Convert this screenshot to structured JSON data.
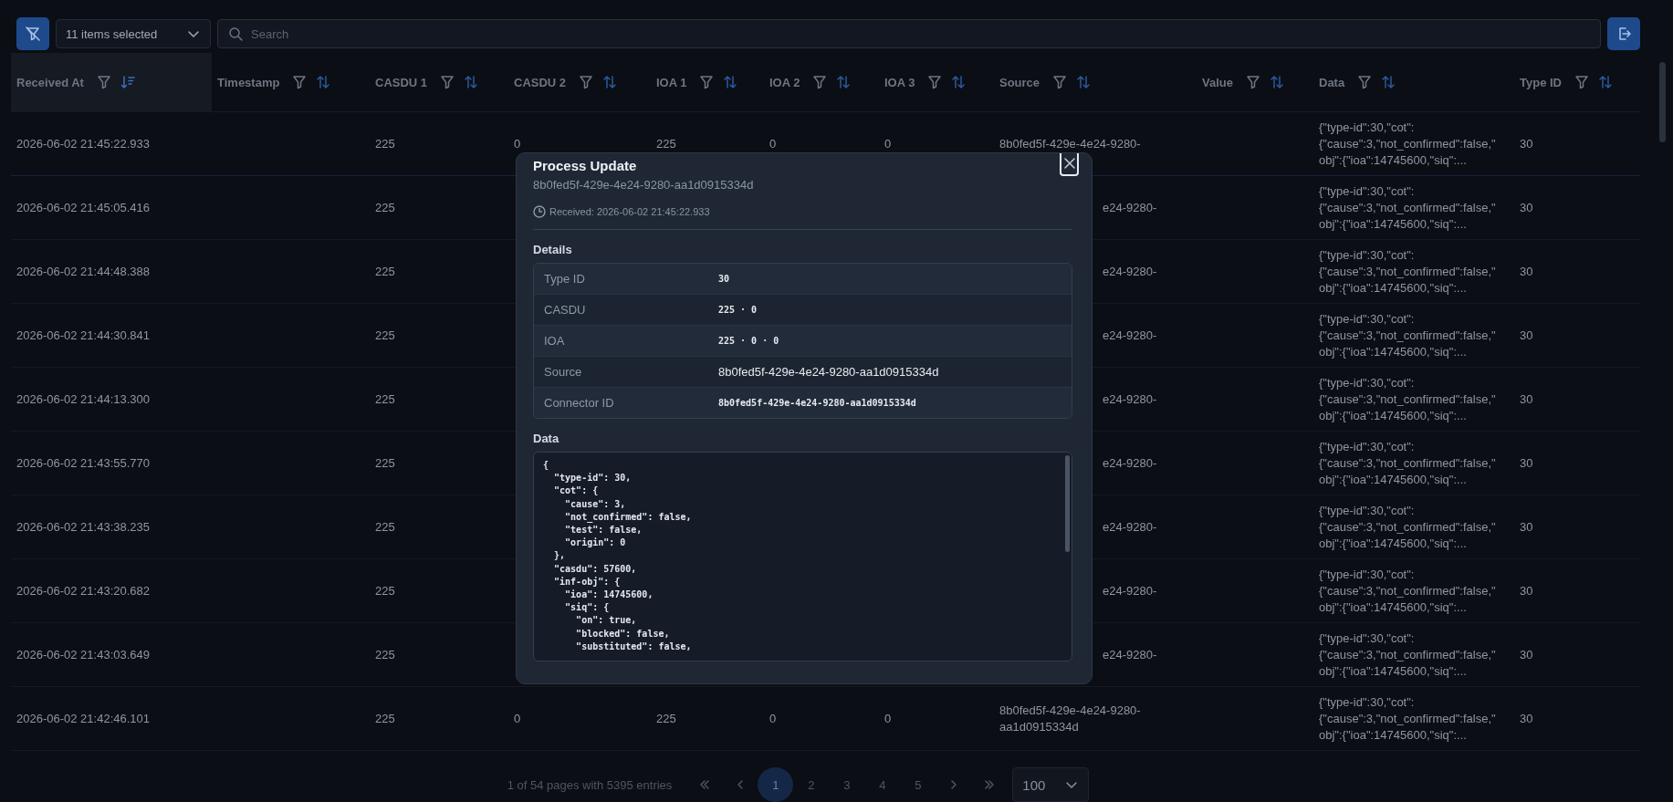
{
  "toolbar": {
    "column_select": "11 items selected",
    "search": {
      "placeholder": "Search"
    }
  },
  "table": {
    "columns": [
      {
        "label": "Received At",
        "sorted": true
      },
      {
        "label": "Timestamp",
        "sorted": false
      },
      {
        "label": "CASDU 1",
        "sorted": false
      },
      {
        "label": "CASDU 2",
        "sorted": false
      },
      {
        "label": "IOA 1",
        "sorted": false
      },
      {
        "label": "IOA 2",
        "sorted": false
      },
      {
        "label": "IOA 3",
        "sorted": false
      },
      {
        "label": "Source",
        "sorted": false
      },
      {
        "label": "Value",
        "sorted": false
      },
      {
        "label": "Data",
        "sorted": false
      },
      {
        "label": "Type ID",
        "sorted": false
      }
    ],
    "rows": [
      {
        "kind": "full",
        "received_at": "2026-06-02 21:45:22.933",
        "casdu_1": "225",
        "casdu_2": "0",
        "ioa_1": "225",
        "ioa_2": "0",
        "ioa_3": "0",
        "source": "8b0fed5f-429e-4e24-9280-",
        "data": [
          "{\"type-id\":30,\"cot\":",
          "{\"cause\":3,\"not_confirmed\":false,\"",
          "obj\":{\"ioa\":14745600,\"siq\":..."
        ],
        "type_id": "30"
      },
      {
        "kind": "partial",
        "received_at": "2026-06-02 21:45:05.416",
        "casdu_1": "225",
        "source": "e24-9280-",
        "data": [
          "{\"type-id\":30,\"cot\":",
          "{\"cause\":3,\"not_confirmed\":false,\"",
          "obj\":{\"ioa\":14745600,\"siq\":..."
        ],
        "type_id": "30"
      },
      {
        "kind": "partial",
        "received_at": "2026-06-02 21:44:48.388",
        "casdu_1": "225",
        "source": "e24-9280-",
        "data": [
          "{\"type-id\":30,\"cot\":",
          "{\"cause\":3,\"not_confirmed\":false,\"",
          "obj\":{\"ioa\":14745600,\"siq\":..."
        ],
        "type_id": "30"
      },
      {
        "kind": "partial",
        "received_at": "2026-06-02 21:44:30.841",
        "casdu_1": "225",
        "source": "e24-9280-",
        "data": [
          "{\"type-id\":30,\"cot\":",
          "{\"cause\":3,\"not_confirmed\":false,\"",
          "obj\":{\"ioa\":14745600,\"siq\":..."
        ],
        "type_id": "30"
      },
      {
        "kind": "partial",
        "received_at": "2026-06-02 21:44:13.300",
        "casdu_1": "225",
        "source": "e24-9280-",
        "data": [
          "{\"type-id\":30,\"cot\":",
          "{\"cause\":3,\"not_confirmed\":false,\"",
          "obj\":{\"ioa\":14745600,\"siq\":..."
        ],
        "type_id": "30"
      },
      {
        "kind": "partial",
        "received_at": "2026-06-02 21:43:55.770",
        "casdu_1": "225",
        "source": "e24-9280-",
        "data": [
          "{\"type-id\":30,\"cot\":",
          "{\"cause\":3,\"not_confirmed\":false,\"",
          "obj\":{\"ioa\":14745600,\"siq\":..."
        ],
        "type_id": "30"
      },
      {
        "kind": "partial",
        "received_at": "2026-06-02 21:43:38.235",
        "casdu_1": "225",
        "source": "e24-9280-",
        "data": [
          "{\"type-id\":30,\"cot\":",
          "{\"cause\":3,\"not_confirmed\":false,\"",
          "obj\":{\"ioa\":14745600,\"siq\":..."
        ],
        "type_id": "30"
      },
      {
        "kind": "partial",
        "received_at": "2026-06-02 21:43:20.682",
        "casdu_1": "225",
        "source": "e24-9280-",
        "data": [
          "{\"type-id\":30,\"cot\":",
          "{\"cause\":3,\"not_confirmed\":false,\"",
          "obj\":{\"ioa\":14745600,\"siq\":..."
        ],
        "type_id": "30"
      },
      {
        "kind": "partial",
        "received_at": "2026-06-02 21:43:03.649",
        "casdu_1": "225",
        "source": "e24-9280-",
        "data": [
          "{\"type-id\":30,\"cot\":",
          "{\"cause\":3,\"not_confirmed\":false,\"",
          "obj\":{\"ioa\":14745600,\"siq\":..."
        ],
        "type_id": "30"
      },
      {
        "kind": "full",
        "received_at": "2026-06-02 21:42:46.101",
        "casdu_1": "225",
        "casdu_2": "0",
        "ioa_1": "225",
        "ioa_2": "0",
        "ioa_3": "0",
        "source": "8b0fed5f-429e-4e24-9280-aa1d0915334d",
        "data": [
          "{\"type-id\":30,\"cot\":",
          "{\"cause\":3,\"not_confirmed\":false,\"",
          "obj\":{\"ioa\":14745600,\"siq\":..."
        ],
        "type_id": "30"
      }
    ]
  },
  "pagination": {
    "summary": "1 of 54 pages with 5395 entries",
    "pages": [
      {
        "label": "1",
        "selected": true
      },
      {
        "label": "2",
        "selected": false
      },
      {
        "label": "3",
        "selected": false
      },
      {
        "label": "4",
        "selected": false
      },
      {
        "label": "5",
        "selected": false
      }
    ],
    "page_size": "100"
  },
  "modal": {
    "title": "Process Update",
    "subtitle": "8b0fed5f-429e-4e24-9280-aa1d0915334d",
    "received": "Received: 2026-06-02 21:45:22.933",
    "details_heading": "Details",
    "details": [
      {
        "label": "Type ID",
        "value": "30",
        "kind": "mono"
      },
      {
        "label": "CASDU",
        "value": "225 · 0",
        "kind": "mono"
      },
      {
        "label": "IOA",
        "value": "225 · 0 · 0",
        "kind": "mono"
      },
      {
        "label": "Source",
        "value": "8b0fed5f-429e-4e24-9280-aa1d0915334d",
        "kind": "text"
      },
      {
        "label": "Connector ID",
        "value": "8b0fed5f-429e-4e24-9280-aa1d0915334d",
        "kind": "mono"
      }
    ],
    "data_heading": "Data",
    "data_code": "{\n  \"type-id\": 30,\n  \"cot\": {\n    \"cause\": 3,\n    \"not_confirmed\": false,\n    \"test\": false,\n    \"origin\": 0\n  },\n  \"casdu\": 57600,\n  \"inf-obj\": {\n    \"ioa\": 14745600,\n    \"siq\": {\n      \"on\": true,\n      \"blocked\": false,\n      \"substituted\": false,"
  }
}
